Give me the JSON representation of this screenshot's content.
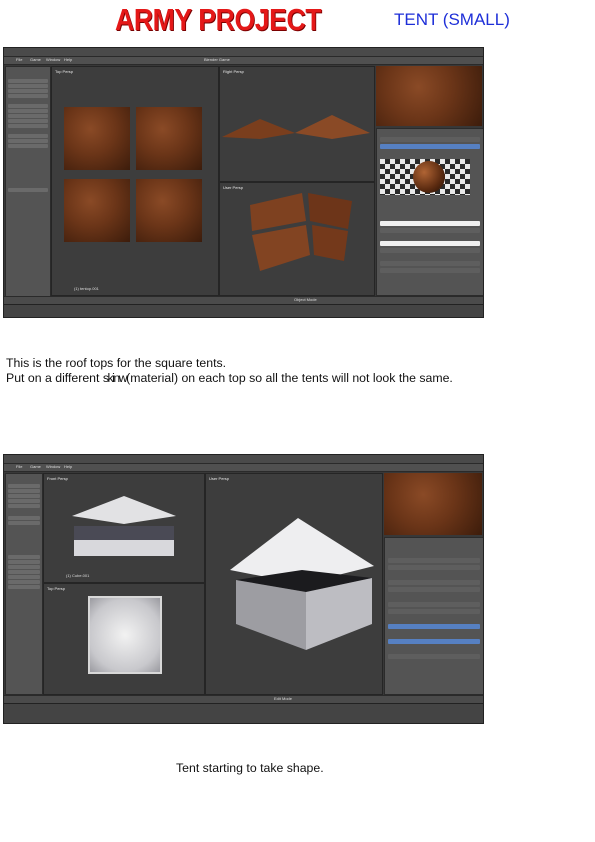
{
  "header": {
    "title": "ARMY PROJECT",
    "subtitle": "TENT  (SMALL)"
  },
  "screenshot1": {
    "title_bar": "Blender  [C:\\Users\\Owner\\Desktop\\army\\army.blend]",
    "menu": [
      "File",
      "Game",
      "Window",
      "Help"
    ],
    "views": [
      "Top Persp",
      "Right Persp",
      "User Persp"
    ],
    "object_label": "(1) tentop.001",
    "mode": "Object Mode",
    "toolshelf": [
      "Transform",
      "Translate",
      "Rotate",
      "Scale",
      "Mirror",
      "Edit",
      "Duplicate",
      "Duplicate Linked",
      "Delete",
      "Join",
      "Set Origin",
      "Shading",
      "Smooth",
      "Flat",
      "Cell Fracture",
      "Cell Fracture",
      "History"
    ],
    "material_sections": [
      "Preview",
      "Diffuse",
      "Specular",
      "Shading"
    ],
    "render_engine": "Blender Game"
  },
  "caption1": {
    "line1": "This is the roof tops for the square tents.",
    "line2_pre": "Put on a different ",
    "line2_strike": "skinw",
    "line2_post": "(material) on each top so all the tents will not look the same."
  },
  "screenshot2": {
    "title_bar": "Blender  [C:\\Users\\Owner\\Desktop\\army\\army.blend]",
    "menu": [
      "File",
      "Game",
      "Window",
      "Help"
    ],
    "views": [
      "Front Persp",
      "Top Persp",
      "User Persp"
    ],
    "object_label": "(1) Cube.001",
    "mode": "Edit Mode",
    "toolshelf": [
      "Transform",
      "Translate",
      "Rotate",
      "Scale",
      "Shrink/Fa",
      "Push/Pull",
      "Mesh Too",
      "Deform",
      "Add",
      "Extrude",
      "Extrude",
      "Extrude",
      "Make Ed",
      "Subdivide",
      "Loop Cut",
      "Edge Slide"
    ],
    "props": [
      "Standalone Player",
      "Start",
      "Resolution",
      "Quality",
      "Stereo",
      "Shading",
      "Multitexture",
      "GLSL",
      "System"
    ],
    "shading_options": [
      "None",
      "Stereo",
      "Dome"
    ]
  },
  "caption2": {
    "text": "Tent starting to take shape."
  }
}
